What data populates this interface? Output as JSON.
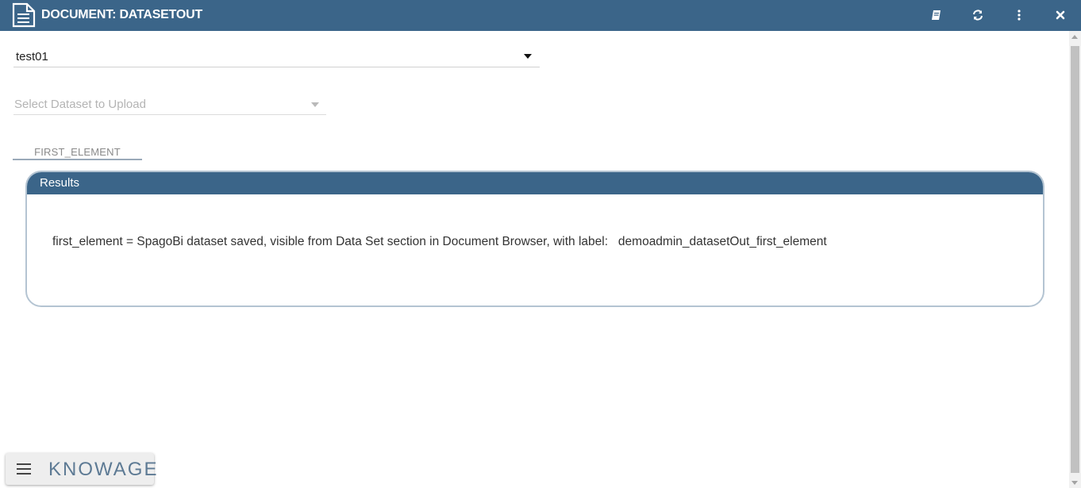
{
  "header": {
    "title": "DOCUMENT: DATASETOUT",
    "icons": [
      "document-icon",
      "book-icon",
      "refresh-icon",
      "more-vert-icon",
      "close-icon"
    ]
  },
  "form": {
    "main_select_value": "test01",
    "dataset_select_placeholder": "Select Dataset to Upload"
  },
  "tabs": [
    {
      "label": "FIRST_ELEMENT"
    }
  ],
  "results": {
    "title": "Results",
    "text": "first_element = SpagoBi dataset saved, visible from Data Set section in Document Browser, with label:   demoadmin_datasetOut_first_element"
  },
  "brand": {
    "logo_text": "KNOWAGE",
    "menu_icon": "hamburger-menu-icon"
  },
  "colors": {
    "header_bg": "#3b6589",
    "results_border": "#b4c4d2",
    "logo": "#5d7a94"
  }
}
